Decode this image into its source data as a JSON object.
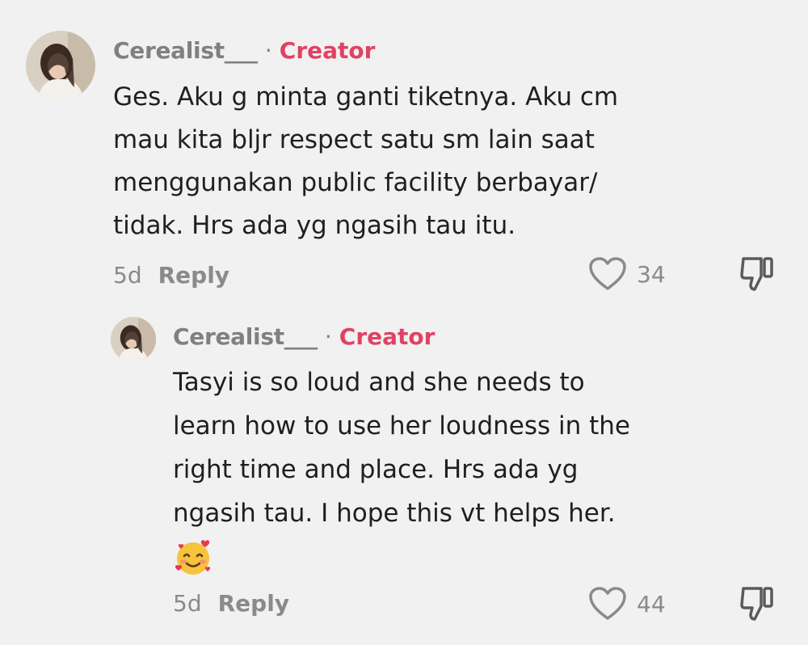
{
  "comments": [
    {
      "username": "Cerealist___",
      "separator": "·",
      "badge": "Creator",
      "lines": [
        "Ges. Aku g minta ganti tiketnya. Aku cm",
        "mau kita bljr respect satu sm lain saat",
        "menggunakan public facility berbayar/",
        "tidak. Hrs ada yg ngasih tau itu."
      ],
      "time": "5d",
      "reply_label": "Reply",
      "like_count": "34"
    },
    {
      "username": "Cerealist___",
      "separator": "·",
      "badge": "Creator",
      "lines": [
        "Tasyi is so loud and she needs to",
        "learn how to use her loudness in the",
        "right time and place. Hrs ada yg",
        "ngasih tau. I hope this vt helps her."
      ],
      "emoji": "smiling-face-with-hearts",
      "time": "5d",
      "reply_label": "Reply",
      "like_count": "44"
    }
  ],
  "colors": {
    "background": "#f1f1f1",
    "creator_badge": "#e04263",
    "muted": "#8a8a8a",
    "text": "#1f1f1f"
  }
}
